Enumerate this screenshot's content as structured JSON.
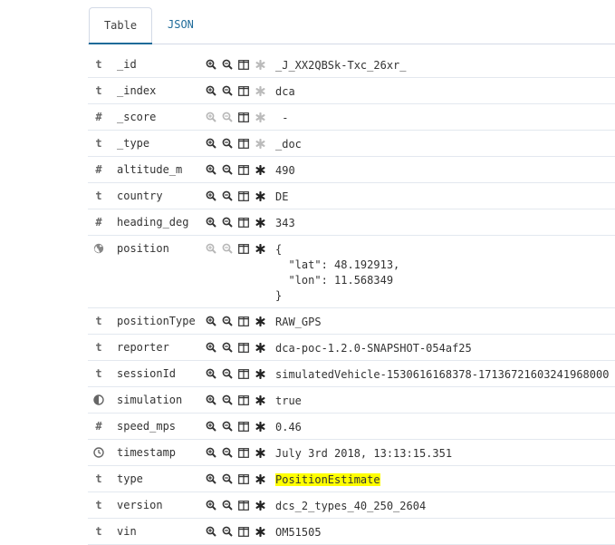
{
  "tabs": {
    "table": "Table",
    "json": "JSON"
  },
  "rows": [
    {
      "type": "t",
      "name": "_id",
      "value": "_J_XX2QBSk-Txc_26xr_",
      "actions_enabled": true,
      "meta": true,
      "highlight": false,
      "height": 28
    },
    {
      "type": "t",
      "name": "_index",
      "value": "dca",
      "actions_enabled": true,
      "meta": true,
      "highlight": false,
      "height": 28
    },
    {
      "type": "#",
      "name": "_score",
      "value": " -",
      "actions_enabled": false,
      "meta": true,
      "highlight": false,
      "height": 28
    },
    {
      "type": "t",
      "name": "_type",
      "value": "_doc",
      "actions_enabled": true,
      "meta": true,
      "highlight": false,
      "height": 28
    },
    {
      "type": "#",
      "name": "altitude_m",
      "value": "490",
      "actions_enabled": true,
      "meta": false,
      "highlight": false,
      "height": 28
    },
    {
      "type": "t",
      "name": "country",
      "value": "DE",
      "actions_enabled": true,
      "meta": false,
      "highlight": false,
      "height": 28
    },
    {
      "type": "#",
      "name": "heading_deg",
      "value": "343",
      "actions_enabled": true,
      "meta": false,
      "highlight": false,
      "height": 28
    },
    {
      "type": "geo",
      "name": "position",
      "value": "{\n  \"lat\": 48.192913,\n  \"lon\": 11.568349\n}",
      "actions_enabled": false,
      "meta": false,
      "highlight": false,
      "height": 79
    },
    {
      "type": "t",
      "name": "positionType",
      "value": "RAW_GPS",
      "actions_enabled": true,
      "meta": false,
      "highlight": false,
      "height": 28
    },
    {
      "type": "t",
      "name": "reporter",
      "value": "dca-poc-1.2.0-SNAPSHOT-054af25",
      "actions_enabled": true,
      "meta": false,
      "highlight": false,
      "height": 28
    },
    {
      "type": "t",
      "name": "sessionId",
      "value": "simulatedVehicle-1530616168378-17136721603241968000",
      "actions_enabled": true,
      "meta": false,
      "highlight": false,
      "height": 28
    },
    {
      "type": "bool",
      "name": "simulation",
      "value": "true",
      "actions_enabled": true,
      "meta": false,
      "highlight": false,
      "height": 28
    },
    {
      "type": "#",
      "name": "speed_mps",
      "value": "0.46",
      "actions_enabled": true,
      "meta": false,
      "highlight": false,
      "height": 28
    },
    {
      "type": "date",
      "name": "timestamp",
      "value": "July 3rd 2018, 13:13:15.351",
      "actions_enabled": true,
      "meta": false,
      "highlight": false,
      "height": 28
    },
    {
      "type": "t",
      "name": "type",
      "value": "PositionEstimate",
      "actions_enabled": true,
      "meta": false,
      "highlight": true,
      "height": 28
    },
    {
      "type": "t",
      "name": "version",
      "value": "dcs_2_types_40_250_2604",
      "actions_enabled": true,
      "meta": false,
      "highlight": false,
      "height": 28
    },
    {
      "type": "t",
      "name": "vin",
      "value": "OM51505",
      "actions_enabled": true,
      "meta": false,
      "highlight": false,
      "height": 28
    }
  ],
  "colors": {
    "accent": "#1f6b99",
    "highlight": "#ffff00",
    "row_border": "#e3e8ef"
  }
}
